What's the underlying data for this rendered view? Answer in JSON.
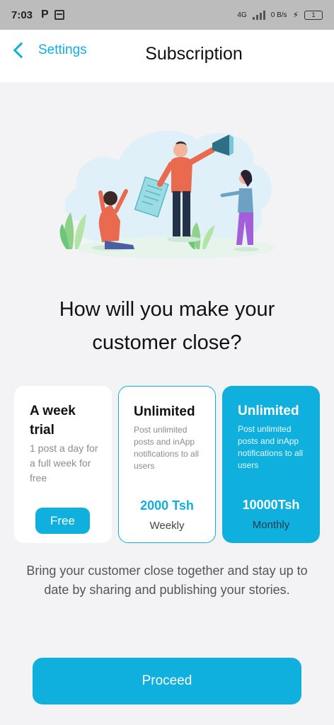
{
  "status_bar": {
    "time": "7:03",
    "network": "4G",
    "speed": "0 B/s",
    "battery": "1"
  },
  "nav": {
    "back_label": "Settings",
    "title": "Subscription"
  },
  "headline": "How will you make your customer close?",
  "plans": [
    {
      "title": "A week trial",
      "description": "1 post a day for a full week for free",
      "cta": "Free"
    },
    {
      "title": "Unlimited",
      "description": "Post unlimited posts and inApp notifications to all users",
      "price": "2000 Tsh",
      "period": "Weekly"
    },
    {
      "title": "Unlimited",
      "description": "Post unlimited posts and inApp notifications to all users",
      "price": "10000Tsh",
      "period": "Monthly"
    }
  ],
  "description": "Bring your customer close together and stay up to date by sharing and publishing your stories.",
  "proceed_label": "Proceed",
  "colors": {
    "accent": "#0fb0dd",
    "background": "#f3f3f5",
    "statusbar": "#bcbcbc"
  }
}
